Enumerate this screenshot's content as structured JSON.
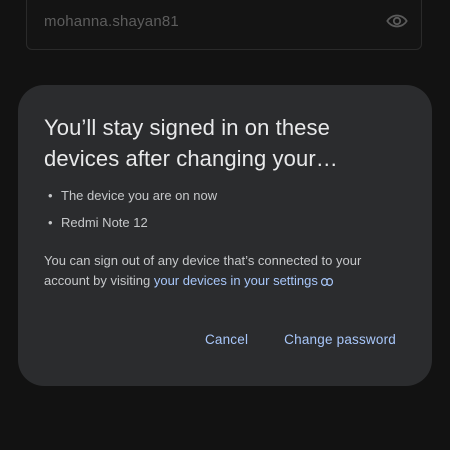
{
  "background": {
    "password_field": {
      "value": "mohanna.shayan81",
      "toggle_icon": "eye-icon"
    }
  },
  "dialog": {
    "title": "You’ll stay signed in on these devices after changing your…",
    "devices": [
      {
        "label": "The device you are on now"
      },
      {
        "label": "Redmi Note 12"
      }
    ],
    "body_prefix": "You can sign out of any device that’s connected to your account by visiting ",
    "settings_link": "your devices in your settings",
    "link_icon": "link-icon",
    "cancel_label": "Cancel",
    "change_password_label": "Change password"
  },
  "colors": {
    "page_bg": "#121212",
    "dialog_bg": "#2b2c2e",
    "accent": "#a8c7fa",
    "title_text": "#e8e9ea",
    "body_text": "#c6c8ca"
  }
}
